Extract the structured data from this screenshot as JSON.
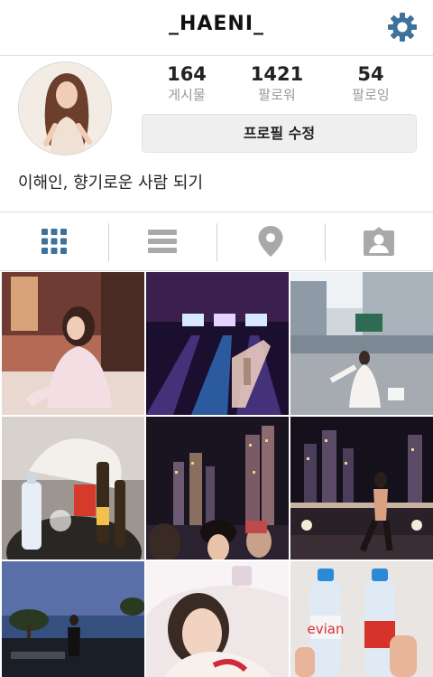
{
  "header": {
    "username": "_HAENI_",
    "settings_icon": "gear-icon",
    "accent_color": "#3f729b"
  },
  "profile": {
    "avatar_icon": "avatar",
    "stats": [
      {
        "value": "164",
        "label": "게시물"
      },
      {
        "value": "1421",
        "label": "팔로워"
      },
      {
        "value": "54",
        "label": "팔로잉"
      }
    ],
    "edit_button_label": "프로필 수정",
    "bio": "이해인, 향기로운 사람 되기"
  },
  "tabs": [
    {
      "icon": "grid-icon",
      "active": true
    },
    {
      "icon": "list-icon",
      "active": false
    },
    {
      "icon": "location-pin-icon",
      "active": false
    },
    {
      "icon": "tagged-person-icon",
      "active": false
    }
  ],
  "photos": [
    {
      "description": "woman in pink sweater at cafe"
    },
    {
      "description": "bowling alley with glass"
    },
    {
      "description": "woman in white at plaza"
    },
    {
      "description": "champagne and snacks table"
    },
    {
      "description": "city skyline at night with friends"
    },
    {
      "description": "woman posing at night skyline"
    },
    {
      "description": "pool at sunset"
    },
    {
      "description": "selfie in white"
    },
    {
      "description": "two water bottles",
      "bottle_label": "evian"
    }
  ]
}
